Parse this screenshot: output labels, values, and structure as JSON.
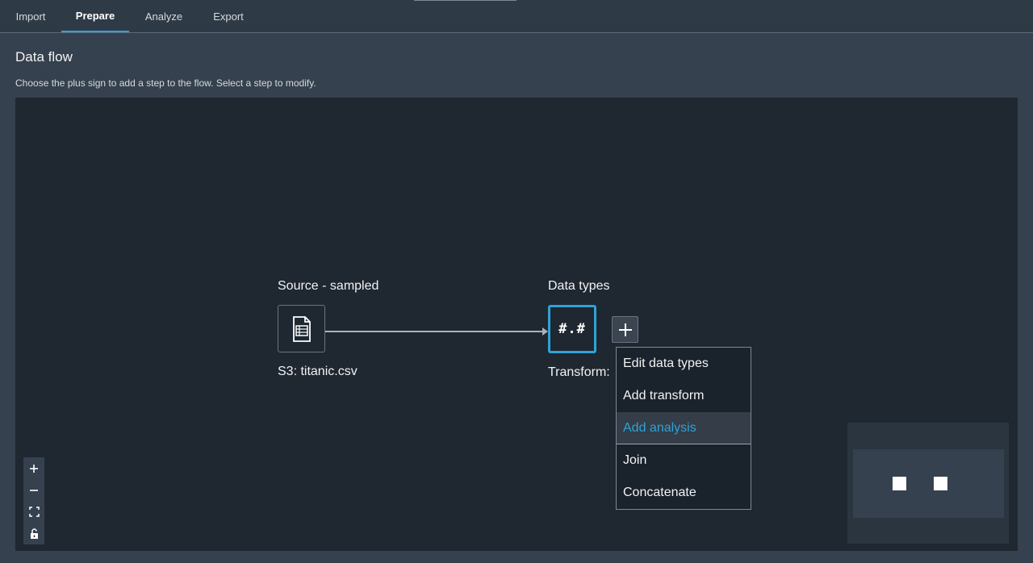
{
  "tabs": [
    {
      "label": "Import"
    },
    {
      "label": "Prepare",
      "active": true
    },
    {
      "label": "Analyze"
    },
    {
      "label": "Export"
    }
  ],
  "page": {
    "title": "Data flow",
    "description": "Choose the plus sign to add a step to the flow. Select a step to modify."
  },
  "flow": {
    "source": {
      "title": "Source - sampled",
      "subtitle": "S3: titanic.csv",
      "icon": "csv-file-icon"
    },
    "step": {
      "title": "Data types",
      "subtitle": "Transform:",
      "glyph": "#.#",
      "icon": "data-types-icon"
    },
    "add_step_icon": "plus-icon"
  },
  "menu": {
    "items": [
      {
        "label": "Edit data types"
      },
      {
        "label": "Add transform"
      },
      {
        "label": "Add analysis",
        "highlighted": true
      },
      {
        "label": "Join"
      },
      {
        "label": "Concatenate"
      }
    ]
  },
  "zoom_controls": [
    "zoom-in-icon",
    "zoom-out-icon",
    "fit-view-icon",
    "lock-icon"
  ],
  "colors": {
    "accent": "#2ea3d6",
    "canvas": "#1f2731",
    "background": "#36414f"
  }
}
